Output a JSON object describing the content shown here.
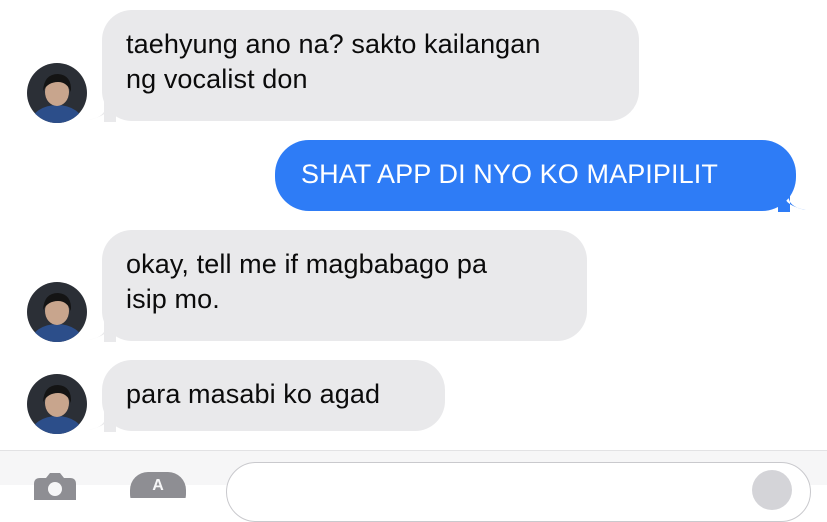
{
  "conversation": {
    "messages": [
      {
        "direction": "incoming",
        "text": "taehyung ano na? sakto kailangan\nng vocalist don"
      },
      {
        "direction": "outgoing",
        "text": "SHAT APP DI NYO KO MAPIPILIT"
      },
      {
        "direction": "incoming",
        "text": "okay, tell me if magbabago pa\nisip mo."
      },
      {
        "direction": "incoming",
        "text": "para masabi ko agad"
      }
    ]
  },
  "composer": {
    "icons": [
      "camera-icon",
      "app-store-icon",
      "audio-icon"
    ],
    "placeholder": ""
  },
  "colors": {
    "incoming_bubble": "#e9e9eb",
    "outgoing_bubble": "#2e7cf6",
    "outgoing_text": "#ffffff",
    "incoming_text": "#0b0b0b"
  }
}
